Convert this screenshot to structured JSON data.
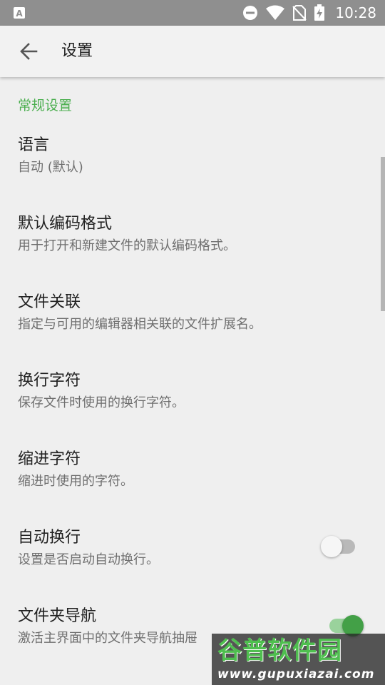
{
  "status_bar": {
    "time": "10:28",
    "icons": [
      "notification-a-icon",
      "do-not-disturb-icon",
      "wifi-icon",
      "no-sim-icon",
      "battery-charging-icon"
    ]
  },
  "app_bar": {
    "title": "设置",
    "back_icon": "arrow-back-icon"
  },
  "settings": {
    "section_header": "常规设置",
    "items": [
      {
        "title": "语言",
        "summary": "自动 (默认)"
      },
      {
        "title": "默认编码格式",
        "summary": "用于打开和新建文件的默认编码格式。"
      },
      {
        "title": "文件关联",
        "summary": "指定与可用的编辑器相关联的文件扩展名。"
      },
      {
        "title": "换行字符",
        "summary": "保存文件时使用的换行字符。"
      },
      {
        "title": "缩进字符",
        "summary": "缩进时使用的字符。"
      },
      {
        "title": "自动换行",
        "summary": "设置是否启动自动换行。",
        "toggle": "off"
      },
      {
        "title": "文件夹导航",
        "summary": "激活主界面中的文件夹导航抽屉",
        "toggle": "on"
      }
    ]
  },
  "watermark": {
    "logo": "谷普软件园",
    "url": "www.gupuxiazai.com"
  },
  "colors": {
    "accent": "#4caf50",
    "status_bar": "#8f8f8f",
    "background": "#efefef"
  }
}
